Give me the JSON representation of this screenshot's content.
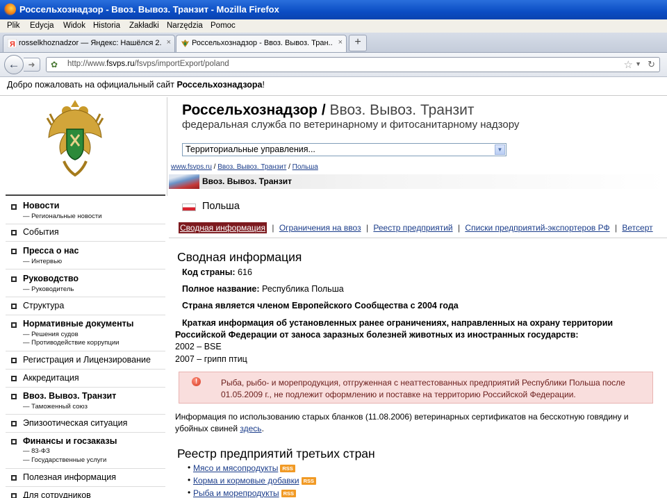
{
  "window": {
    "title": "Россельхознадзор - Ввоз. Вывоз. Транзит - Mozilla Firefox"
  },
  "menu": [
    "Plik",
    "Edycja",
    "Widok",
    "Historia",
    "Zakładki",
    "Narzędzia",
    "Pomoc"
  ],
  "tabs": [
    {
      "label": "rosselkhoznadzor — Яндекс: Нашёлся 2...",
      "close": "×"
    },
    {
      "label": "Россельхознадзор - Ввоз. Вывоз. Тран...",
      "close": "×"
    }
  ],
  "newtab": "+",
  "url": {
    "prefix": "http://www.",
    "domain": "fsvps.ru",
    "path": "/fsvps/importExport/poland"
  },
  "welcome": {
    "text": "Добро пожаловать на официальный сайт ",
    "bold": "Россельхознадзора",
    "end": "!"
  },
  "header": {
    "brand": "Россельхознадзор",
    "slash": " / ",
    "section": "Ввоз. Вывоз. Транзит",
    "subtitle": "федеральная служба по ветеринарному и фитосанитарному надзору",
    "select_value": "Территориальные управления..."
  },
  "breadcrumb": [
    "www.fsvps.ru",
    "Ввоз. Вывоз. Транзит",
    "Польша"
  ],
  "breadcrumb_sep": " / ",
  "section_bar": "Ввоз. Вывоз. Транзит",
  "sidebar": [
    {
      "label": "Новости",
      "bold": true,
      "subs": [
        "— Региональные новости"
      ]
    },
    {
      "label": "События",
      "bold": false,
      "subs": []
    },
    {
      "label": "Пресса о нас",
      "bold": true,
      "subs": [
        "— Интервью"
      ]
    },
    {
      "label": "Руководство",
      "bold": true,
      "subs": [
        "— Руководитель"
      ]
    },
    {
      "label": "Структура",
      "bold": false,
      "subs": []
    },
    {
      "label": "Нормативные документы",
      "bold": true,
      "subs": [
        "— Решения судов",
        "— Противодействие коррупции"
      ]
    },
    {
      "label": "Регистрация и Лицензирование",
      "bold": false,
      "subs": []
    },
    {
      "label": "Аккредитация",
      "bold": false,
      "subs": []
    },
    {
      "label": "Ввоз. Вывоз. Транзит",
      "bold": true,
      "subs": [
        "— Таможенный союз"
      ]
    },
    {
      "label": "Эпизоотическая ситуация",
      "bold": false,
      "subs": []
    },
    {
      "label": "Финансы и госзаказы",
      "bold": true,
      "subs": [
        "— 83-ФЗ",
        "— Государственные услуги"
      ]
    },
    {
      "label": "Полезная информация",
      "bold": false,
      "subs": []
    },
    {
      "label": "Для сотрудников",
      "bold": false,
      "subs": []
    }
  ],
  "country": "Польша",
  "content_tabs": [
    "Сводная информация",
    "Ограничения на ввоз",
    "Реестр предприятий",
    "Списки предприятий-экспортеров РФ",
    "Ветсерт"
  ],
  "tab_sep": "|",
  "summary": {
    "heading": "Сводная информация",
    "code_label": "Код страны:",
    "code_value": " 616",
    "fullname_label": "Полное название:",
    "fullname_value": " Республика Польша",
    "eu_text": "Страна является членом Европейского Сообщества с 2004 года",
    "brief_line1": "Краткая информация об установленных ранее ограничениях, направленных на охрану территории",
    "brief_line2": "Российской Федерации от заноса заразных болезней животных из иностранных государств:",
    "restrictions": [
      "2002 – BSE",
      "2007 – грипп птиц"
    ]
  },
  "alert": {
    "icon": "!",
    "text": "Рыба, рыбо- и морепродукция, отгруженная с неаттестованных предприятий Республики Польша после 01.05.2009 г., не подлежит оформлению и поставке на территорию Российской Федерации."
  },
  "info": {
    "text": "Информация по использованию старых бланков (11.08.2006) ветеринарных сертификатов на бесскотную говядину и убойных свиней ",
    "link": "здесь",
    "end": "."
  },
  "registry": {
    "heading": "Реестр предприятий третьих стран",
    "rss_label": "RSS",
    "items": [
      "Мясо и мясопродукты",
      "Корма и кормовые добавки",
      "Рыба и морепродукты"
    ]
  },
  "colors": {
    "titlebar": "#0b4dc4",
    "active_tab": "#7d1a1f",
    "alert_bg": "#f9dedd",
    "link": "#1a3c8a"
  }
}
